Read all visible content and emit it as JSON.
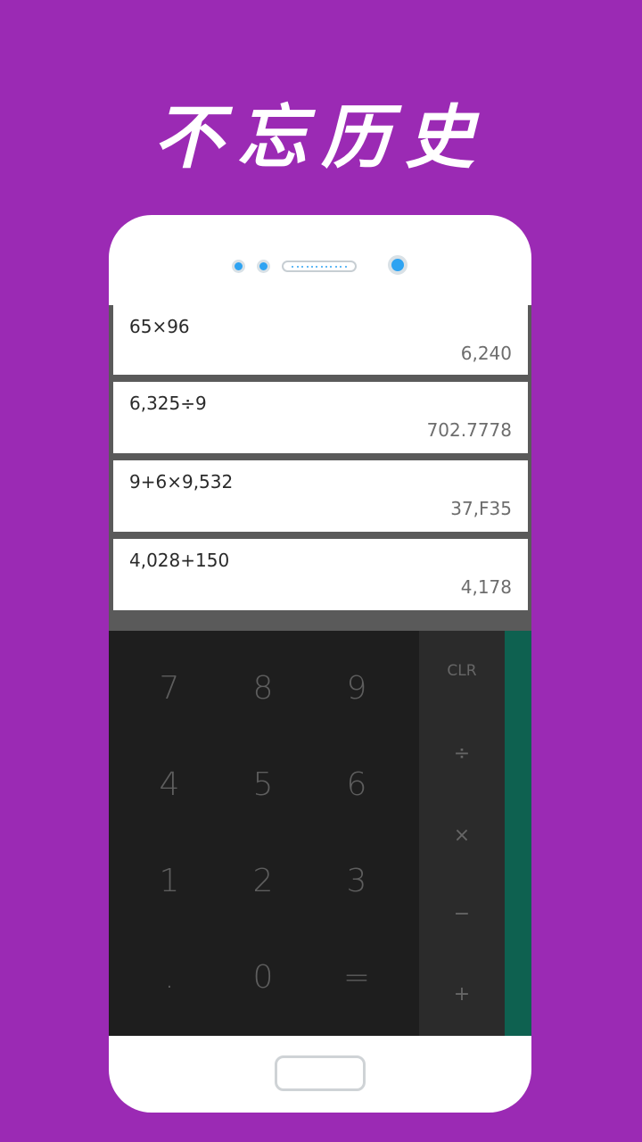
{
  "headline": "不忘历史",
  "history": [
    {
      "expression": "65×96",
      "result": "6,240"
    },
    {
      "expression": "6,325÷9",
      "result": "702.7778"
    },
    {
      "expression": "9+6×9,532",
      "result": "37,F35"
    },
    {
      "expression": "4,028+150",
      "result": "4,178"
    }
  ],
  "keypad": {
    "digits": [
      "7",
      "8",
      "9",
      "4",
      "5",
      "6",
      "1",
      "2",
      "3",
      ".",
      "0",
      "="
    ]
  },
  "operators": {
    "clear": "CLR",
    "divide": "÷",
    "multiply": "×",
    "subtract": "−",
    "add": "+"
  },
  "colors": {
    "background": "#9b2ab4",
    "accent": "#0e6150",
    "keypad": "#1e1e1e",
    "operator_panel": "#2b2b2b"
  }
}
